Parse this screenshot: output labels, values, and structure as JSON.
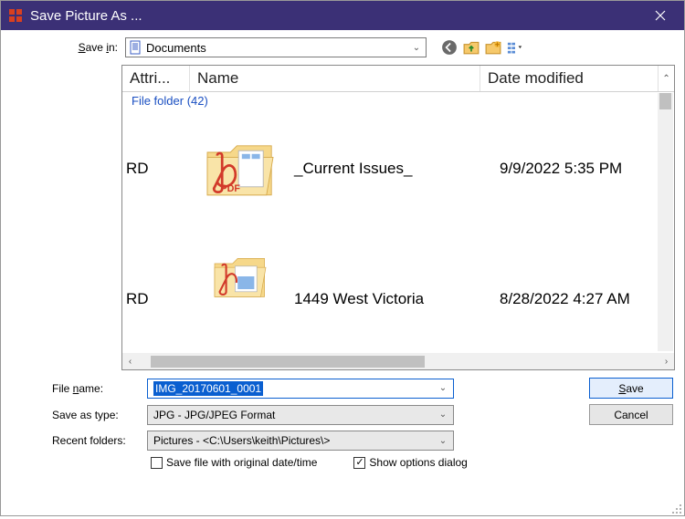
{
  "window": {
    "title": "Save Picture As ..."
  },
  "top": {
    "save_in_label": "Save in:",
    "save_in_value": "Documents"
  },
  "columns": {
    "attributes": "Attri...",
    "name": "Name",
    "date": "Date modified"
  },
  "group": {
    "label": "File folder (42)"
  },
  "rows": [
    {
      "attr": "RD",
      "name": "_Current Issues_",
      "date": "9/9/2022 5:35 PM"
    },
    {
      "attr": "RD",
      "name": "1449 West Victoria",
      "date": "8/28/2022 4:27 AM"
    }
  ],
  "bottom": {
    "file_name_label": "File name:",
    "file_name_value": "IMG_20170601_0001",
    "save_as_type_label": "Save as type:",
    "save_as_type_value": "JPG - JPG/JPEG Format",
    "recent_folders_label": "Recent folders:",
    "recent_folders_value": "Pictures  -  <C:\\Users\\keith\\Pictures\\>",
    "save_button": "Save",
    "cancel_button": "Cancel",
    "check_original": "Save file with original date/time",
    "check_options": "Show options dialog",
    "checkmark": "✓"
  }
}
